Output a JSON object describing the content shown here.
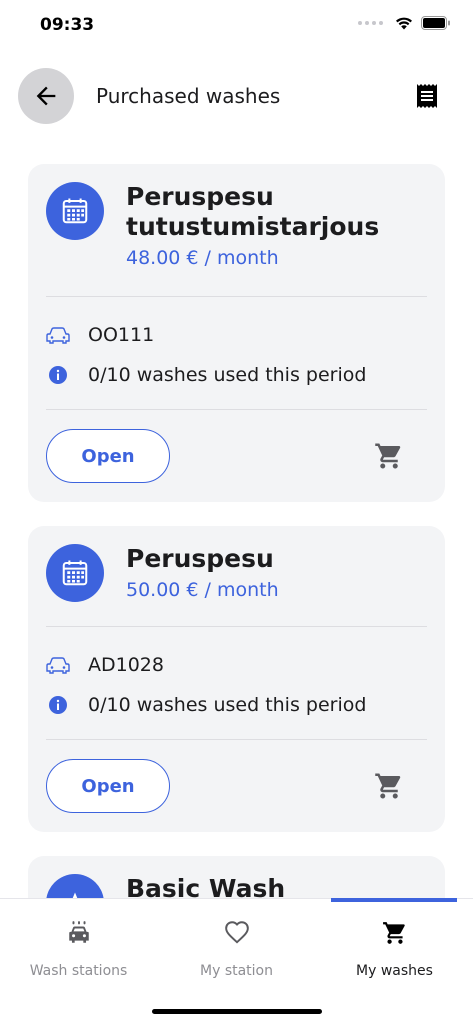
{
  "status_bar": {
    "time": "09:33"
  },
  "header": {
    "title": "Purchased washes",
    "back_icon": "arrow-left-icon",
    "receipt_icon": "receipt-icon"
  },
  "cards": [
    {
      "name": "Peruspesu tutustumistarjous",
      "price": "48.00 € / month",
      "plate": "OO111",
      "usage": "0/10 washes used this period",
      "open_label": "Open"
    },
    {
      "name": "Peruspesu",
      "price": "50.00 € / month",
      "plate": "AD1028",
      "usage": "0/10 washes used this period",
      "open_label": "Open"
    },
    {
      "name": "Basic Wash"
    }
  ],
  "tabs": [
    {
      "label": "Wash stations",
      "icon": "car-wash-icon"
    },
    {
      "label": "My station",
      "icon": "heart-icon"
    },
    {
      "label": "My washes",
      "icon": "cart-icon",
      "active": true
    }
  ],
  "colors": {
    "accent": "#3d63dd",
    "card_bg": "#f3f4f6",
    "muted": "#8e8e93"
  }
}
